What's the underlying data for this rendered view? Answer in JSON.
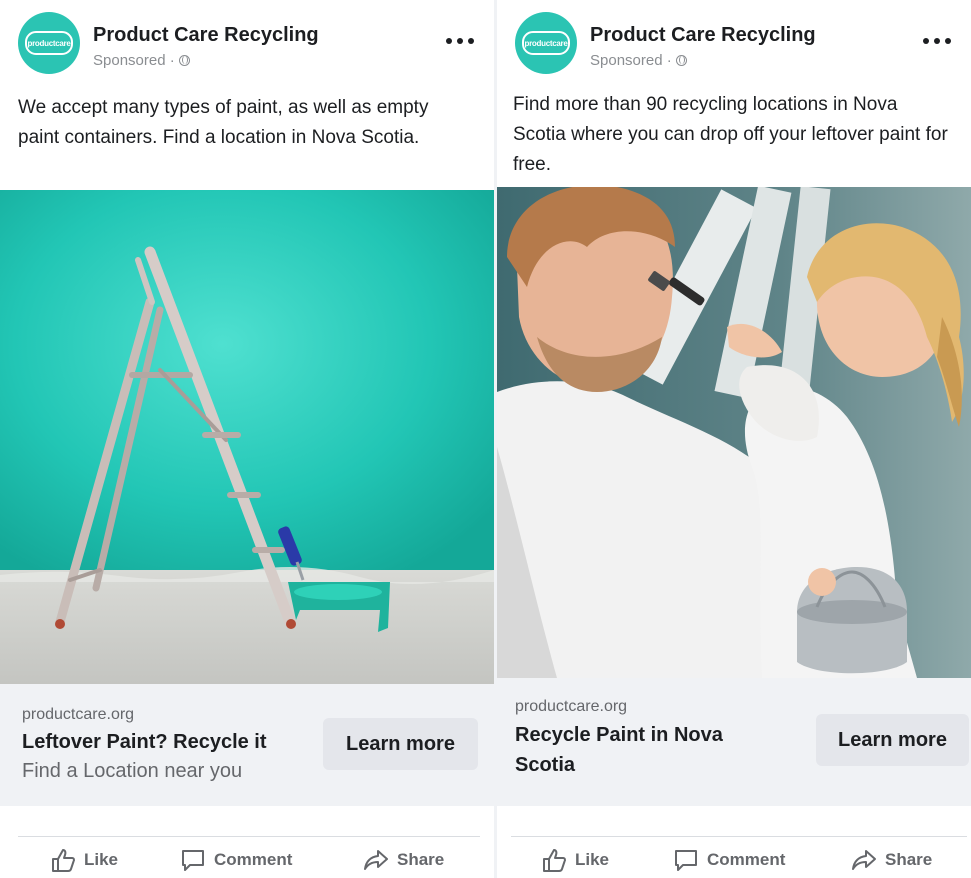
{
  "colors": {
    "brand_teal": "#2bc4b3",
    "preview_bg": "#f0f2f5",
    "button_bg": "#e4e6eb",
    "muted_text": "#65676b"
  },
  "posts": [
    {
      "page_name": "Product Care Recycling",
      "logo_text": "productcare",
      "meta_label": "Sponsored ·",
      "privacy_icon": "globe-icon",
      "body_text": "We accept many types of paint, as well as empty paint containers. Find a location in Nova Scotia.",
      "image_icon": "ladder-paint-roller-photo",
      "link_domain": "productcare.org",
      "headline": "Leftover Paint? Recycle it",
      "description": "Find a Location near you",
      "cta_label": "Learn more",
      "actions": {
        "like": "Like",
        "comment": "Comment",
        "share": "Share"
      }
    },
    {
      "page_name": "Product Care Recycling",
      "logo_text": "productcare",
      "meta_label": "Sponsored ·",
      "privacy_icon": "globe-icon",
      "body_text": "Find more than 90 recycling locations in Nova Scotia where you can drop off your leftover paint for free.",
      "image_icon": "father-and-child-painting-photo",
      "link_domain": "productcare.org",
      "headline": "Recycle Paint in Nova Scotia",
      "description": "",
      "cta_label": "Learn more",
      "actions": {
        "like": "Like",
        "comment": "Comment",
        "share": "Share"
      }
    }
  ]
}
